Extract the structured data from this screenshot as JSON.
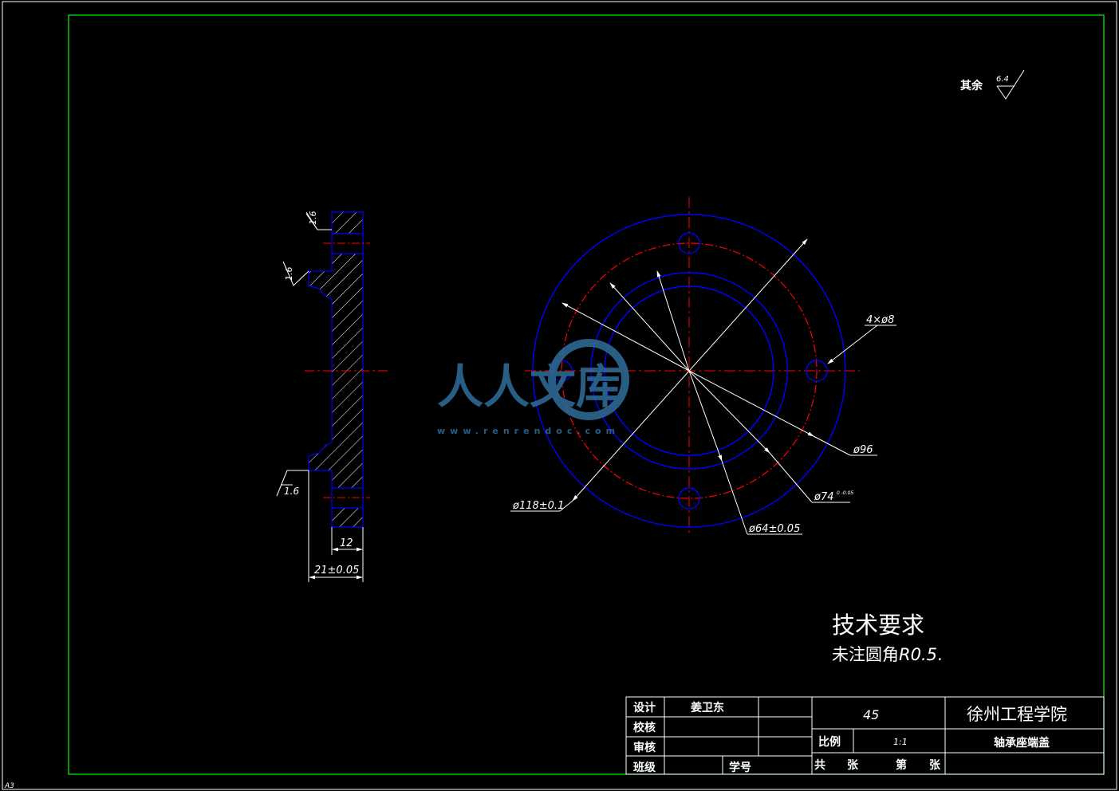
{
  "colors": {
    "background": "#000000",
    "frame_outer": "#ffffff",
    "frame_inner": "#00ff00",
    "outline": "#0000ff",
    "center_line": "#ff0000",
    "dimension": "#ffffff",
    "watermark": "#2f6e9c"
  },
  "corner_label": "A3",
  "surface_finish": {
    "prefix": "其余",
    "value": "6.4"
  },
  "side_view": {
    "roughness_top": "1.6",
    "roughness_mid": "1.6",
    "roughness_bottom": "1.6",
    "dim_thickness": "12",
    "dim_total": "21±0.05"
  },
  "front_view": {
    "holes_label": "4×ø8",
    "dia_96": "ø96",
    "dia_74": "ø74",
    "dia_74_tol": "0\n-0.05",
    "dia_118": "ø118±0.1",
    "dia_64": "ø64±0.05"
  },
  "watermark": {
    "text": "人人文库",
    "url": "www.renrendoc.com"
  },
  "tech_requirements": {
    "heading": "技术要求",
    "line1": "未注圆角",
    "line1_value": "R0.5",
    "line1_end": "."
  },
  "title_block": {
    "design_label": "设计",
    "designer": "姜卫东",
    "check_label": "校核",
    "review_label": "审核",
    "class_label": "班级",
    "student_no_label": "学号",
    "material": "45",
    "school": "徐州工程学院",
    "scale_label": "比例",
    "scale_value": "1:1",
    "part_name": "轴承座端盖",
    "sheets_total": "共",
    "sheets_unit1": "张",
    "sheet_no": "第",
    "sheets_unit2": "张"
  }
}
